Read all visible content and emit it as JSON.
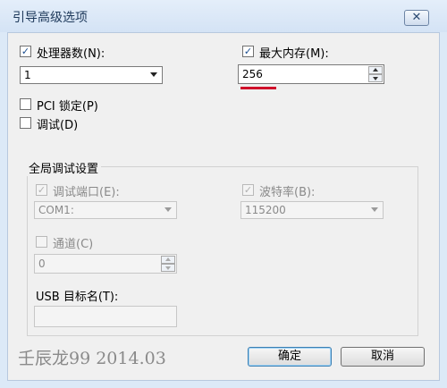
{
  "window": {
    "title": "引导高级选项",
    "close_glyph": "✕"
  },
  "processors": {
    "label": "处理器数(N):",
    "checked": true,
    "value": "1"
  },
  "max_memory": {
    "label": "最大内存(M):",
    "checked": true,
    "value": "256"
  },
  "pci_lock": {
    "label": "PCI 锁定(P)",
    "checked": false
  },
  "debug": {
    "label": "调试(D)",
    "checked": false
  },
  "global_debug": {
    "legend": "全局调试设置",
    "debug_port": {
      "label": "调试端口(E):",
      "checked": true,
      "enabled": false,
      "value": "COM1:"
    },
    "baud_rate": {
      "label": "波特率(B):",
      "checked": true,
      "enabled": false,
      "value": "115200"
    },
    "channel": {
      "label": "通道(C)",
      "checked": false,
      "enabled": false,
      "value": "0"
    },
    "usb_target": {
      "label": "USB 目标名(T):",
      "value": ""
    }
  },
  "buttons": {
    "ok": "确定",
    "cancel": "取消"
  },
  "watermark": "壬辰龙99  2014.03",
  "colors": {
    "accent_underline": "#d0112b",
    "title_text": "#1e395b"
  },
  "icons": {
    "check": "✓"
  }
}
